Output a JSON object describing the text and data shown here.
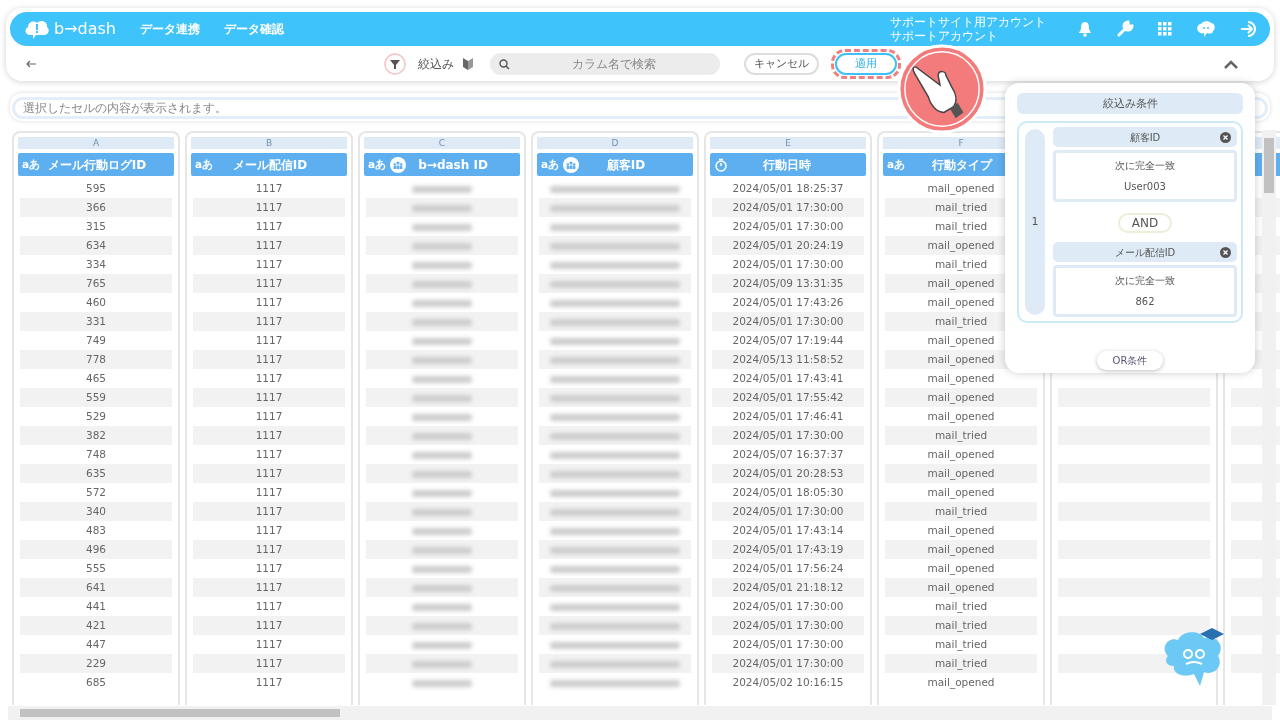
{
  "navbar": {
    "logo": "b→dash",
    "links": [
      "データ連携",
      "データ確認"
    ],
    "account_lines": [
      "サポートサイト用アカウント",
      "サポートアカウント"
    ]
  },
  "toolbar": {
    "filter_label": "絞込み",
    "search": {
      "placeholder": "カラム名で検索"
    },
    "cancel": "キャンセル",
    "apply": "適用"
  },
  "cell_display": {
    "placeholder": "選択したセルの内容が表示されます。"
  },
  "columns": [
    {
      "letter": "A",
      "title": "メール行動ログID",
      "kind": "text",
      "type_label": "aあ",
      "cells": [
        "595",
        "366",
        "315",
        "634",
        "334",
        "765",
        "460",
        "331",
        "749",
        "778",
        "465",
        "559",
        "529",
        "382",
        "748",
        "635",
        "572",
        "340",
        "483",
        "496",
        "555",
        "641",
        "441",
        "421",
        "447",
        "229",
        "685"
      ]
    },
    {
      "letter": "B",
      "title": "メール配信ID",
      "kind": "text",
      "type_label": "aあ",
      "cells": [
        "1117",
        "1117",
        "1117",
        "1117",
        "1117",
        "1117",
        "1117",
        "1117",
        "1117",
        "1117",
        "1117",
        "1117",
        "1117",
        "1117",
        "1117",
        "1117",
        "1117",
        "1117",
        "1117",
        "1117",
        "1117",
        "1117",
        "1117",
        "1117",
        "1117",
        "1117",
        "1117"
      ]
    },
    {
      "letter": "C",
      "title": "b→dash ID",
      "kind": "blurred",
      "type_label": "aあ",
      "group_icon": true
    },
    {
      "letter": "D",
      "title": "顧客ID",
      "kind": "blurred",
      "type_label": "aあ",
      "group_icon": true
    },
    {
      "letter": "E",
      "title": "行動日時",
      "kind": "datetime",
      "cells": [
        "2024/05/01 18:25:37",
        "2024/05/01 17:30:00",
        "2024/05/01 17:30:00",
        "2024/05/01 20:24:19",
        "2024/05/01 17:30:00",
        "2024/05/09 13:31:35",
        "2024/05/01 17:43:26",
        "2024/05/01 17:30:00",
        "2024/05/07 17:19:44",
        "2024/05/13 11:58:52",
        "2024/05/01 17:43:41",
        "2024/05/01 17:55:42",
        "2024/05/01 17:46:41",
        "2024/05/01 17:30:00",
        "2024/05/07 16:37:37",
        "2024/05/01 20:28:53",
        "2024/05/01 18:05:30",
        "2024/05/01 17:30:00",
        "2024/05/01 17:43:14",
        "2024/05/01 17:43:19",
        "2024/05/01 17:56:24",
        "2024/05/01 21:18:12",
        "2024/05/01 17:30:00",
        "2024/05/01 17:30:00",
        "2024/05/01 17:30:00",
        "2024/05/01 17:30:00",
        "2024/05/02 10:16:15"
      ]
    },
    {
      "letter": "F",
      "title": "行動タイプ",
      "kind": "text",
      "type_label": "aあ",
      "cells": [
        "mail_opened",
        "mail_tried",
        "mail_tried",
        "mail_opened",
        "mail_tried",
        "mail_opened",
        "mail_opened",
        "mail_tried",
        "mail_opened",
        "mail_opened",
        "mail_opened",
        "mail_opened",
        "mail_opened",
        "mail_tried",
        "mail_opened",
        "mail_opened",
        "mail_opened",
        "mail_tried",
        "mail_opened",
        "mail_opened",
        "mail_opened",
        "mail_opened",
        "mail_tried",
        "mail_tried",
        "mail_tried",
        "mail_tried",
        "mail_opened"
      ]
    },
    {
      "kind": "blank"
    },
    {
      "kind": "blank"
    }
  ],
  "filter_panel": {
    "title": "絞込み条件",
    "groups": [
      {
        "number": "1",
        "conditions": [
          {
            "column": "顧客ID",
            "operator": "次に完全一致",
            "value": "User003"
          },
          {
            "column": "メール配信ID",
            "operator": "次に完全一致",
            "value": "862"
          }
        ],
        "joiner": "AND"
      }
    ],
    "or_button": "OR条件"
  }
}
